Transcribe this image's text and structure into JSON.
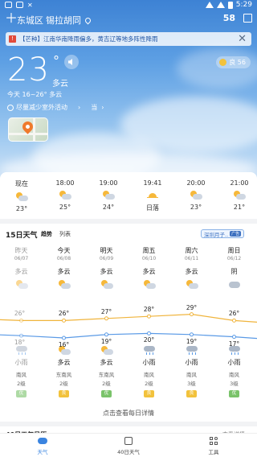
{
  "status_bar": {
    "time": "5:29"
  },
  "header": {
    "district": "东城区",
    "street": "锡拉胡同",
    "aqi_value": "58"
  },
  "alert": {
    "text": "【芒种】江南华南降雨偏多，黄吉辽等地多阵性降雨"
  },
  "current": {
    "temperature": "23",
    "degree_symbol": "°",
    "condition": "多云",
    "today_range": "今天 16~26°  多云",
    "tip": "尽量减少室外活动",
    "tip_extra": "当",
    "aqi_pill": "良 56"
  },
  "hourly": [
    {
      "time": "现在",
      "icon": "partly-cloudy-icon",
      "value": "23°"
    },
    {
      "time": "18:00",
      "icon": "partly-cloudy-icon",
      "value": "25°"
    },
    {
      "time": "19:00",
      "icon": "partly-cloudy-icon",
      "value": "24°"
    },
    {
      "time": "19:41",
      "icon": "sunset-icon",
      "value": "日落"
    },
    {
      "time": "20:00",
      "icon": "partly-cloudy-icon",
      "value": "23°"
    },
    {
      "time": "21:00",
      "icon": "partly-cloudy-icon",
      "value": "21°"
    }
  ],
  "forecast": {
    "title": "15日天气",
    "tab_trend": "趋势",
    "tab_list": "列表",
    "badge": "深圳月子..",
    "badge_sub": "广告",
    "days": [
      {
        "name": "昨天",
        "date": "06/07",
        "day_cond": "多云",
        "high": "26°",
        "low": "18°",
        "night_cond": "小雨",
        "wind": "南风",
        "level": "2级",
        "aqi": "优",
        "past": true
      },
      {
        "name": "今天",
        "date": "06/08",
        "day_cond": "多云",
        "high": "26°",
        "low": "16°",
        "night_cond": "多云",
        "wind": "东南风",
        "level": "2级",
        "aqi": "良",
        "past": false
      },
      {
        "name": "明天",
        "date": "06/09",
        "day_cond": "多云",
        "high": "27°",
        "low": "19°",
        "night_cond": "多云",
        "wind": "东南风",
        "level": "2级",
        "aqi": "优",
        "past": false
      },
      {
        "name": "周五",
        "date": "06/10",
        "day_cond": "多云",
        "high": "28°",
        "low": "20°",
        "night_cond": "小雨",
        "wind": "南风",
        "level": "2级",
        "aqi": "良",
        "past": false
      },
      {
        "name": "周六",
        "date": "06/11",
        "day_cond": "多云",
        "high": "29°",
        "low": "19°",
        "night_cond": "小雨",
        "wind": "南风",
        "level": "3级",
        "aqi": "良",
        "past": false
      },
      {
        "name": "周日",
        "date": "06/12",
        "day_cond": "阴",
        "high": "26°",
        "low": "17°",
        "night_cond": "小雨",
        "wind": "南风",
        "level": "3级",
        "aqi": "优",
        "past": false
      }
    ],
    "detail_link": "点击查看每日详情"
  },
  "next_section": {
    "title": "40日天气日历",
    "more": "查看详情 >"
  },
  "tabbar": [
    {
      "label": "天气",
      "icon": "weather-icon",
      "active": true
    },
    {
      "label": "40日天气",
      "icon": "calendar-icon",
      "active": false
    },
    {
      "label": "工具",
      "icon": "grid-icon",
      "active": false
    }
  ],
  "colors": {
    "accent": "#3a84e0",
    "high_line": "#f0b43c",
    "low_line": "#5a9ae6",
    "aqi_good": "#f2c23c",
    "aqi_excellent": "#7ac36a"
  }
}
